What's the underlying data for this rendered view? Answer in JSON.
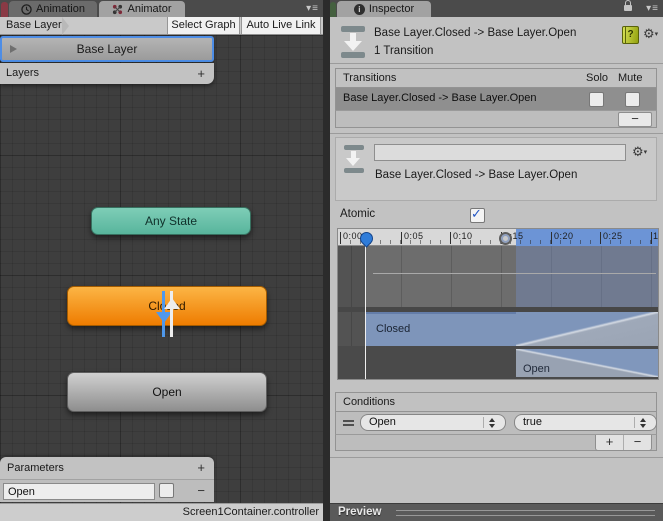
{
  "animator_panel": {
    "tabs": {
      "animation": "Animation",
      "animator": "Animator"
    },
    "menu_glyph": "▾≡",
    "breadcrumb": "Base Layer",
    "select_graph": "Select Graph",
    "auto_live_link": "Auto Live Link",
    "layer_row": "Base Layer",
    "layers": {
      "label": "Layers",
      "add": "+"
    },
    "nodes": {
      "any_state": "Any State",
      "closed": "Closed",
      "open": "Open"
    },
    "parameters": {
      "label": "Parameters",
      "add": "+",
      "name": "Open",
      "remove": "−"
    },
    "status": "Screen1Container.controller"
  },
  "inspector_panel": {
    "tab": "Inspector",
    "info_glyph": "i",
    "menu_glyph": "▾≡",
    "header": {
      "title": "Base Layer.Closed -> Base Layer.Open",
      "subtitle": "1 Transition",
      "help_glyph": "?",
      "gear_glyph": "⚙"
    },
    "transitions": {
      "title": "Transitions",
      "solo": "Solo",
      "mute": "Mute",
      "row": "Base Layer.Closed -> Base Layer.Open",
      "remove": "−"
    },
    "detail": {
      "name_value": "",
      "label": "Base Layer.Closed -> Base Layer.Open",
      "gear_glyph": "⚙"
    },
    "atomic": {
      "label": "Atomic",
      "check_glyph": "✓"
    },
    "timeline": {
      "ticks": [
        "0:00",
        "0:05",
        "0:10",
        "0:15",
        "0:20",
        "0:25",
        "1"
      ],
      "closed_clip": "Closed",
      "open_clip": "Open"
    },
    "conditions": {
      "title": "Conditions",
      "parameter": "Open",
      "value": "true",
      "add": "+",
      "remove": "−"
    },
    "preview": "Preview"
  },
  "colors": {
    "selection_blue": "#4D8DE6",
    "node_orange": "#EE7C00",
    "node_teal": "#5FB99F",
    "timeline_bar_blue": "#7E95BA",
    "ruler_blue": "#6C94D6",
    "arrow_blue": "#4F98EA"
  }
}
